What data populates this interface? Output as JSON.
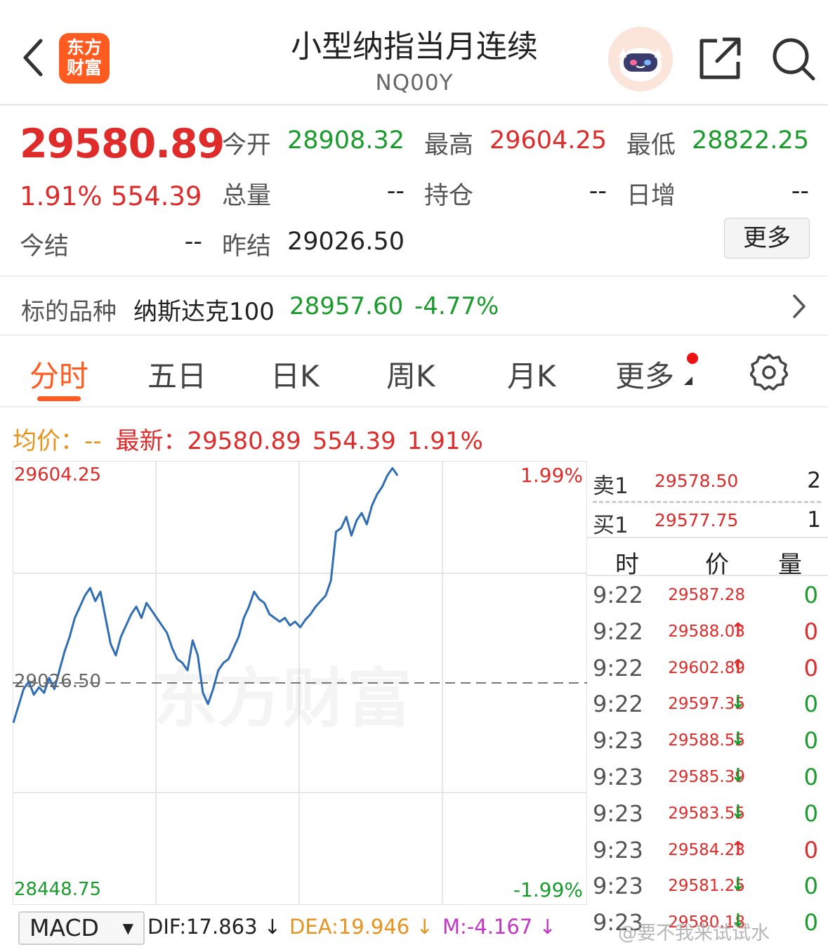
{
  "header": {
    "logo_line1": "东方",
    "logo_line2": "财富",
    "title": "小型纳指当月连续",
    "code": "NQ00Y"
  },
  "quote": {
    "last_price": "29580.89",
    "change_pct": "1.91%",
    "change_amt": "554.39",
    "open_label": "今开",
    "open_value": "28908.32",
    "high_label": "最高",
    "high_value": "29604.25",
    "low_label": "最低",
    "low_value": "28822.25",
    "volume_label": "总量",
    "volume_value": "--",
    "oi_label": "持仓",
    "oi_value": "--",
    "daily_inc_label": "日增",
    "daily_inc_value": "--",
    "settle_label": "今结",
    "settle_value": "--",
    "prev_settle_label": "昨结",
    "prev_settle_value": "29026.50",
    "more_label": "更多"
  },
  "underlying": {
    "label": "标的品种",
    "name": "纳斯达克100",
    "value": "28957.60",
    "change": "-4.77%"
  },
  "tabs": {
    "items": [
      "分时",
      "五日",
      "日K",
      "周K",
      "月K",
      "更多"
    ],
    "active": 0
  },
  "infoline": {
    "avg_label": "均价：",
    "avg_value": "--",
    "latest_label": "最新：",
    "latest_value": "29580.89",
    "latest_change": "554.39",
    "latest_pct": "1.91%"
  },
  "chart_data": {
    "type": "line",
    "ymax_label": "29604.25",
    "ymin_label": "28448.75",
    "prev_label": "29026.50",
    "ymax_pct": "1.99%",
    "ymin_pct": "-1.99%",
    "watermark": "东方财富",
    "ylim": [
      28448.75,
      29604.25
    ],
    "reference": 29026.5,
    "line_color": "#2f6db5",
    "x_fraction_end": 0.67,
    "y": [
      28920,
      28965,
      29010,
      29030,
      28995,
      29015,
      29000,
      29040,
      29010,
      29060,
      29110,
      29150,
      29200,
      29230,
      29260,
      29280,
      29245,
      29270,
      29200,
      29130,
      29100,
      29150,
      29180,
      29210,
      29230,
      29200,
      29240,
      29220,
      29200,
      29180,
      29160,
      29120,
      29090,
      29080,
      29060,
      29140,
      29100,
      29000,
      28970,
      29010,
      29060,
      29080,
      29090,
      29120,
      29150,
      29200,
      29230,
      29270,
      29250,
      29240,
      29210,
      29200,
      29190,
      29200,
      29180,
      29190,
      29175,
      29195,
      29210,
      29230,
      29245,
      29260,
      29300,
      29430,
      29440,
      29470,
      29420,
      29460,
      29480,
      29450,
      29500,
      29530,
      29550,
      29580,
      29600,
      29580
    ]
  },
  "orderbook": {
    "ask_label": "卖1",
    "ask_price": "29578.50",
    "ask_qty": "2",
    "bid_label": "买1",
    "bid_price": "29577.75",
    "bid_qty": "1",
    "head_time": "时",
    "head_price": "价",
    "head_qty": "量"
  },
  "ticks": [
    {
      "time": "9:22",
      "price": "29587.28",
      "arrow": "",
      "qty": "0"
    },
    {
      "time": "9:22",
      "price": "29588.03",
      "arrow": "↑",
      "qty": "0"
    },
    {
      "time": "9:22",
      "price": "29602.89",
      "arrow": "↑",
      "qty": "0"
    },
    {
      "time": "9:22",
      "price": "29597.35",
      "arrow": "↓",
      "qty": "0"
    },
    {
      "time": "9:23",
      "price": "29588.55",
      "arrow": "↓",
      "qty": "0"
    },
    {
      "time": "9:23",
      "price": "29585.39",
      "arrow": "↓",
      "qty": "0"
    },
    {
      "time": "9:23",
      "price": "29583.55",
      "arrow": "↓",
      "qty": "0"
    },
    {
      "time": "9:23",
      "price": "29584.23",
      "arrow": "↑",
      "qty": "0"
    },
    {
      "time": "9:23",
      "price": "29581.25",
      "arrow": "↓",
      "qty": "0"
    },
    {
      "time": "9:23",
      "price": "29580.18",
      "arrow": "↓",
      "qty": "0"
    }
  ],
  "macd": {
    "selector": "MACD",
    "dif": "DIF:17.863 ↓",
    "dea": "DEA:19.946 ↓",
    "m": "M:-4.167 ↓"
  },
  "watermark": "@要不我来试试水",
  "colors": {
    "up": "#e02b2b",
    "down": "#1a9c2c",
    "accent": "#ff5a1f",
    "line": "#2f6db5"
  }
}
